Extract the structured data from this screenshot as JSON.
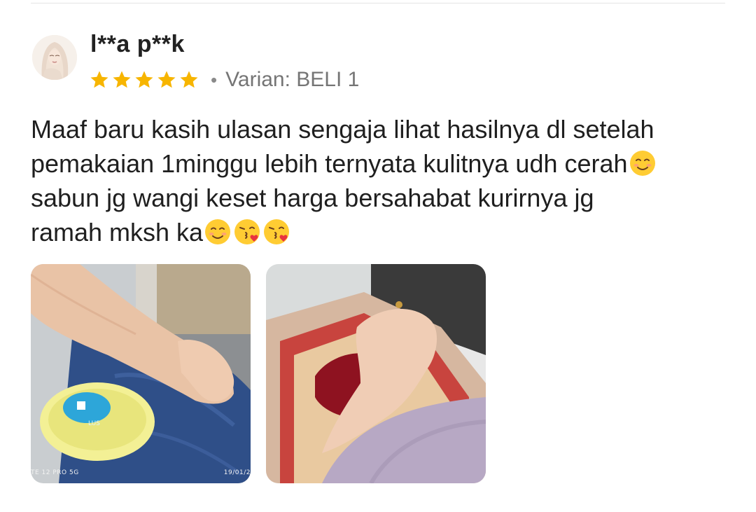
{
  "review": {
    "username": "l**a p**k",
    "rating": 5,
    "rating_max": 5,
    "separator": "•",
    "variant": "Varian: BELI 1",
    "text_line1": "Maaf baru kasih ulasan sengaja lihat hasilnya dl setelah",
    "text_line2": "pemakaian 1minggu lebih ternyata kulitnya udh cerah",
    "text_line3": "sabun jg wangi keset harga bersahabat kurirnya jg",
    "text_line4": "ramah mksh ka",
    "emojis": [
      "smiling-face-icon",
      "smiling-face-icon",
      "face-blowing-kiss-icon",
      "face-blowing-kiss-icon"
    ]
  },
  "photos": [
    {
      "name": "review-photo-1",
      "watermark_left": "TE 12 PRO 5G",
      "watermark_right": "19/01/2"
    },
    {
      "name": "review-photo-2"
    }
  ],
  "colors": {
    "star": "#F7B500",
    "text": "#1f1f1f",
    "muted": "#757575"
  }
}
